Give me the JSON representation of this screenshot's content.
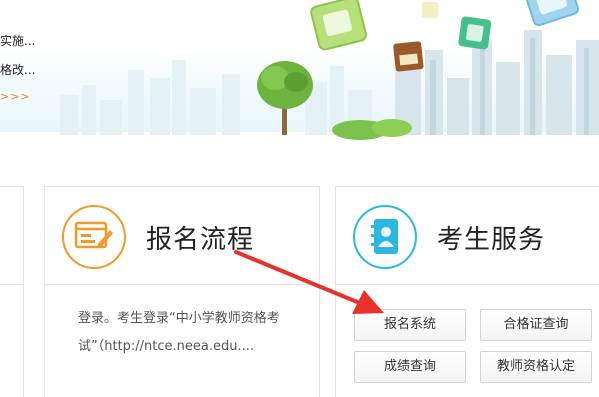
{
  "banner": {
    "line1": "实施...",
    "line2": "格改...",
    "more": ">>>"
  },
  "cards": {
    "signup": {
      "title": "报名流程",
      "icon": "form-edit-icon",
      "description": "登录。考生登录“中小学教师资格考试”（http://ntce.neea.edu...."
    },
    "service": {
      "title": "考生服务",
      "icon": "contact-book-icon",
      "buttons": {
        "register": "报名系统",
        "certificate": "合格证查询",
        "score": "成绩查询",
        "qualification": "教师资格认定"
      }
    }
  },
  "colors": {
    "signup_accent": "#f19a2a",
    "service_accent": "#29b8e3",
    "arrow": "#e8312b",
    "more_link": "#f08a00"
  }
}
